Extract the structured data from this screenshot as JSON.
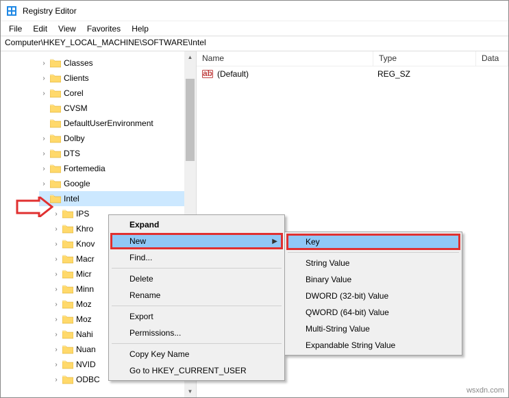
{
  "window": {
    "title": "Registry Editor"
  },
  "menubar": [
    "File",
    "Edit",
    "View",
    "Favorites",
    "Help"
  ],
  "address": "Computer\\HKEY_LOCAL_MACHINE\\SOFTWARE\\Intel",
  "tree": {
    "items": [
      {
        "label": "Classes",
        "expander": ">"
      },
      {
        "label": "Clients",
        "expander": ">"
      },
      {
        "label": "Corel",
        "expander": ">"
      },
      {
        "label": "CVSM",
        "expander": ""
      },
      {
        "label": "DefaultUserEnvironment",
        "expander": ""
      },
      {
        "label": "Dolby",
        "expander": ">"
      },
      {
        "label": "DTS",
        "expander": ">"
      },
      {
        "label": "Fortemedia",
        "expander": ">"
      },
      {
        "label": "Google",
        "expander": ">"
      },
      {
        "label": "Intel",
        "expander": "",
        "selected": true,
        "level": 1
      },
      {
        "label": "IPS",
        "expander": ">",
        "level": 2
      },
      {
        "label": "Khro",
        "expander": ">",
        "level": 2
      },
      {
        "label": "Knov",
        "expander": ">",
        "level": 2
      },
      {
        "label": "Macr",
        "expander": ">",
        "level": 2
      },
      {
        "label": "Micr",
        "expander": ">",
        "level": 2
      },
      {
        "label": "Minn",
        "expander": ">",
        "level": 2
      },
      {
        "label": "Moz",
        "expander": ">",
        "level": 2
      },
      {
        "label": "Moz",
        "expander": ">",
        "level": 2
      },
      {
        "label": "Nahi",
        "expander": ">",
        "level": 2
      },
      {
        "label": "Nuan",
        "expander": ">",
        "level": 2
      },
      {
        "label": "NVID",
        "expander": ">",
        "level": 2
      },
      {
        "label": "ODBC",
        "expander": ">",
        "level": 2
      }
    ]
  },
  "list": {
    "columns": {
      "name": "Name",
      "type": "Type",
      "data": "Data"
    },
    "rows": [
      {
        "name": "(Default)",
        "type": "REG_SZ",
        "data": ""
      }
    ]
  },
  "ctx": {
    "expand": "Expand",
    "new": "New",
    "find": "Find...",
    "delete": "Delete",
    "rename": "Rename",
    "export": "Export",
    "permissions": "Permissions...",
    "copykey": "Copy Key Name",
    "goto": "Go to HKEY_CURRENT_USER"
  },
  "submenu": {
    "key": "Key",
    "string": "String Value",
    "binary": "Binary Value",
    "dword": "DWORD (32-bit) Value",
    "qword": "QWORD (64-bit) Value",
    "multi": "Multi-String Value",
    "expand": "Expandable String Value"
  },
  "watermark": "wsxdn.com"
}
